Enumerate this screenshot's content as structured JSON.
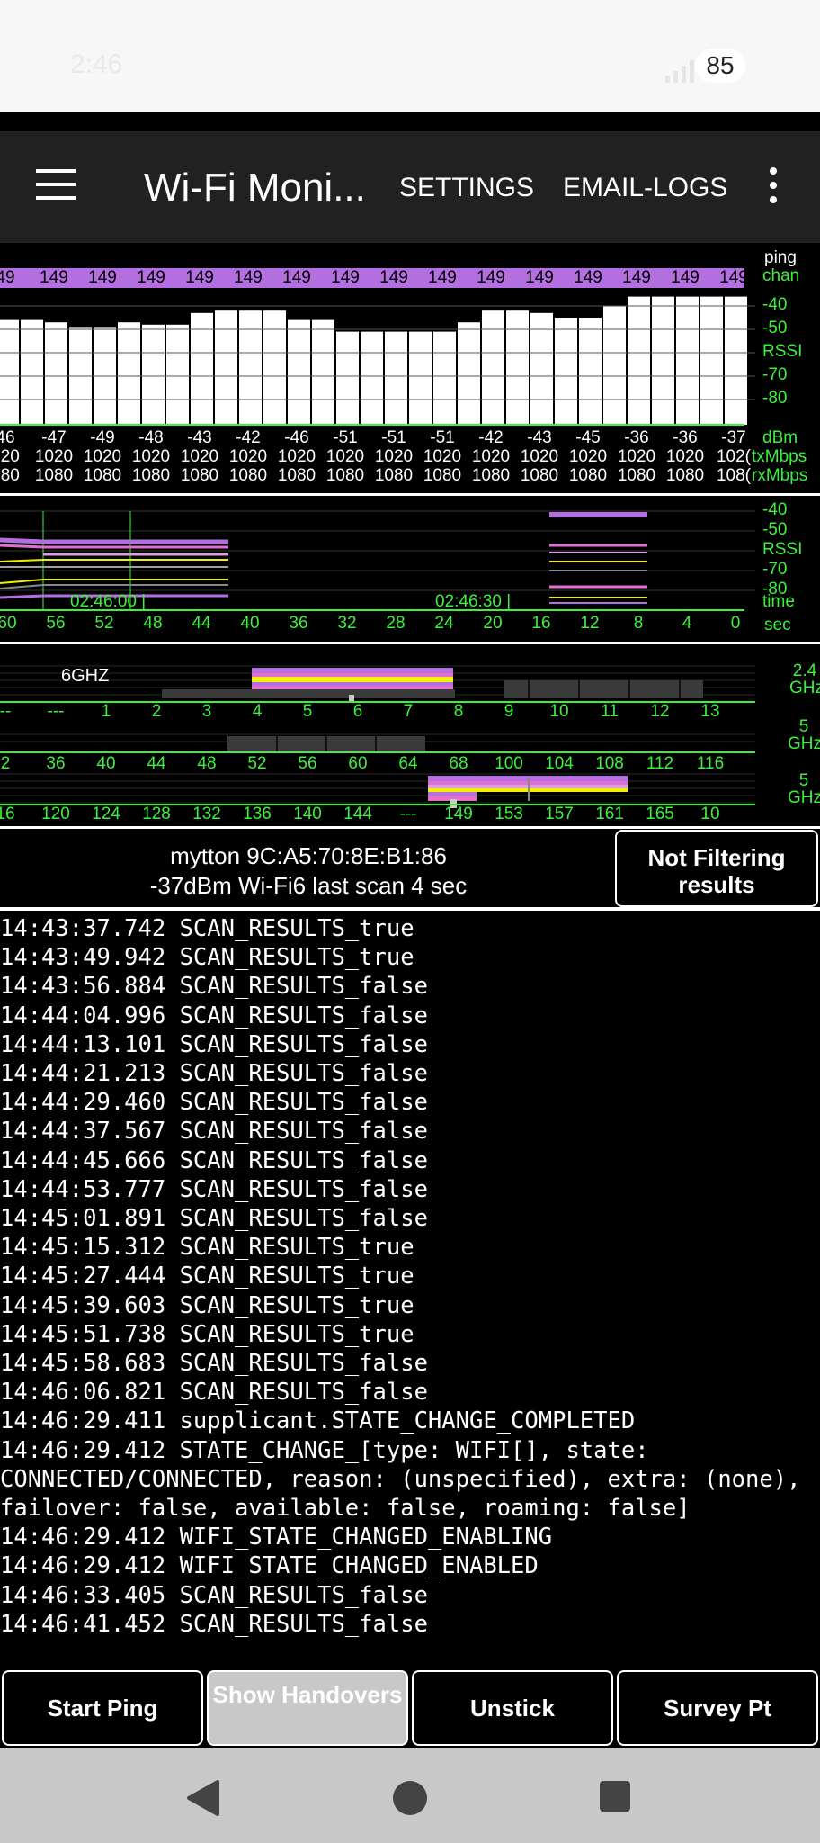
{
  "status_bar": {
    "time": "2:46",
    "battery": "85",
    "signal_icon": "signal-icon",
    "wifi_icon": "wifi-icon"
  },
  "app_bar": {
    "title": "Wi-Fi Moni...",
    "settings": "SETTINGS",
    "email_logs": "EMAIL-LOGS",
    "menu_icon": "hamburger-icon",
    "more_icon": "more-vert-icon"
  },
  "colors": {
    "accent_green": "#3cf03c",
    "channel_bar": "#b36ee0",
    "yellow": "#f0f000",
    "pink": "#e070d0"
  },
  "history_graph": {
    "right_labels": {
      "ping": "ping",
      "chan": "chan",
      "rssi": "RSSI",
      "dbm": "dBm",
      "tx": "txMbps",
      "rx": "rxMbps"
    },
    "rssi_ticks": [
      "-40",
      "-50",
      "RSSI",
      "-70",
      "-80"
    ],
    "chan_values": [
      "49",
      "149",
      "149",
      "149",
      "149",
      "149",
      "149",
      "149",
      "149",
      "149",
      "149",
      "149",
      "149",
      "149",
      "149",
      "149"
    ],
    "dbm_values": [
      "46",
      "-47",
      "-49",
      "-48",
      "-43",
      "-42",
      "-46",
      "-51",
      "-51",
      "-51",
      "-42",
      "-43",
      "-45",
      "-36",
      "-36",
      "-37"
    ],
    "tx_values": [
      "020",
      "1020",
      "1020",
      "1020",
      "1020",
      "1020",
      "1020",
      "1020",
      "1020",
      "1020",
      "1020",
      "1020",
      "1020",
      "1020",
      "1020",
      "102("
    ],
    "rx_values": [
      "080",
      "1080",
      "1080",
      "1080",
      "1080",
      "1080",
      "1080",
      "1080",
      "1080",
      "1080",
      "1080",
      "1080",
      "1080",
      "1080",
      "1080",
      "108("
    ],
    "bar_rssi": [
      -46,
      -46,
      -47,
      -49,
      -49,
      -47,
      -48,
      -48,
      -43,
      -42,
      -42,
      -42,
      -46,
      -46,
      -51,
      -51,
      -51,
      -51,
      -51,
      -47,
      -42,
      -42,
      -43,
      -45,
      -45,
      -40,
      -36,
      -36,
      -36,
      -36,
      -36
    ]
  },
  "scan_graph": {
    "rssi_ticks": [
      "-40",
      "-50",
      "RSSI",
      "-70",
      "-80"
    ],
    "time_label": "time",
    "sec_label": "sec",
    "time_marks": [
      "02:46:00 |",
      "02:46:30 |"
    ],
    "sec_ticks": [
      "60",
      "56",
      "52",
      "48",
      "44",
      "40",
      "36",
      "32",
      "28",
      "24",
      "20",
      "16",
      "12",
      "8",
      "4",
      "0"
    ]
  },
  "channel_graph": {
    "band_label": "6GHZ",
    "band_24": "2.4 GHz",
    "band_5": "5 GHz",
    "band_5b": "5 GHz",
    "row1_ticks": [
      "--",
      "---",
      "1",
      "2",
      "3",
      "4",
      "5",
      "6",
      "7",
      "8",
      "9",
      "10",
      "11",
      "12",
      "13"
    ],
    "row2_ticks": [
      "2",
      "36",
      "40",
      "44",
      "48",
      "52",
      "56",
      "60",
      "64",
      "68",
      "100",
      "104",
      "108",
      "112",
      "116"
    ],
    "row3_ticks": [
      "16",
      "120",
      "124",
      "128",
      "132",
      "136",
      "140",
      "144",
      "---",
      "149",
      "153",
      "157",
      "161",
      "165",
      "10"
    ]
  },
  "connection": {
    "ssid_line": "mytton   9C:A5:70:8E:B1:86",
    "detail_line": "-37dBm  Wi-Fi6  last scan 4 sec",
    "filter_button": "Not Filtering results"
  },
  "log_lines": [
    "14:43:37.742 SCAN_RESULTS_true",
    "14:43:49.942 SCAN_RESULTS_true",
    "14:43:56.884 SCAN_RESULTS_false",
    "14:44:04.996 SCAN_RESULTS_false",
    "14:44:13.101 SCAN_RESULTS_false",
    "14:44:21.213 SCAN_RESULTS_false",
    "14:44:29.460 SCAN_RESULTS_false",
    "14:44:37.567 SCAN_RESULTS_false",
    "14:44:45.666 SCAN_RESULTS_false",
    "14:44:53.777 SCAN_RESULTS_false",
    "14:45:01.891 SCAN_RESULTS_false",
    "14:45:15.312 SCAN_RESULTS_true",
    "14:45:27.444 SCAN_RESULTS_true",
    "14:45:39.603 SCAN_RESULTS_true",
    "14:45:51.738 SCAN_RESULTS_true",
    "14:45:58.683 SCAN_RESULTS_false",
    "14:46:06.821 SCAN_RESULTS_false",
    "14:46:29.411 supplicant.STATE_CHANGE_COMPLETED",
    "14:46:29.412 STATE_CHANGE_[type: WIFI[], state: CONNECTED/CONNECTED, reason: (unspecified), extra: (none), failover: false, available: false, roaming: false]",
    "14:46:29.412 WIFI_STATE_CHANGED_ENABLING",
    "14:46:29.412 WIFI_STATE_CHANGED_ENABLED",
    "14:46:33.405 SCAN_RESULTS_false",
    "14:46:41.452 SCAN_RESULTS_false"
  ],
  "buttons": {
    "start_ping": "Start Ping",
    "show_handovers": "Show Handovers",
    "unstick": "Unstick",
    "survey_pt": "Survey Pt"
  },
  "nav": {
    "back": "back-icon",
    "home": "home-icon",
    "recents": "recents-icon"
  }
}
